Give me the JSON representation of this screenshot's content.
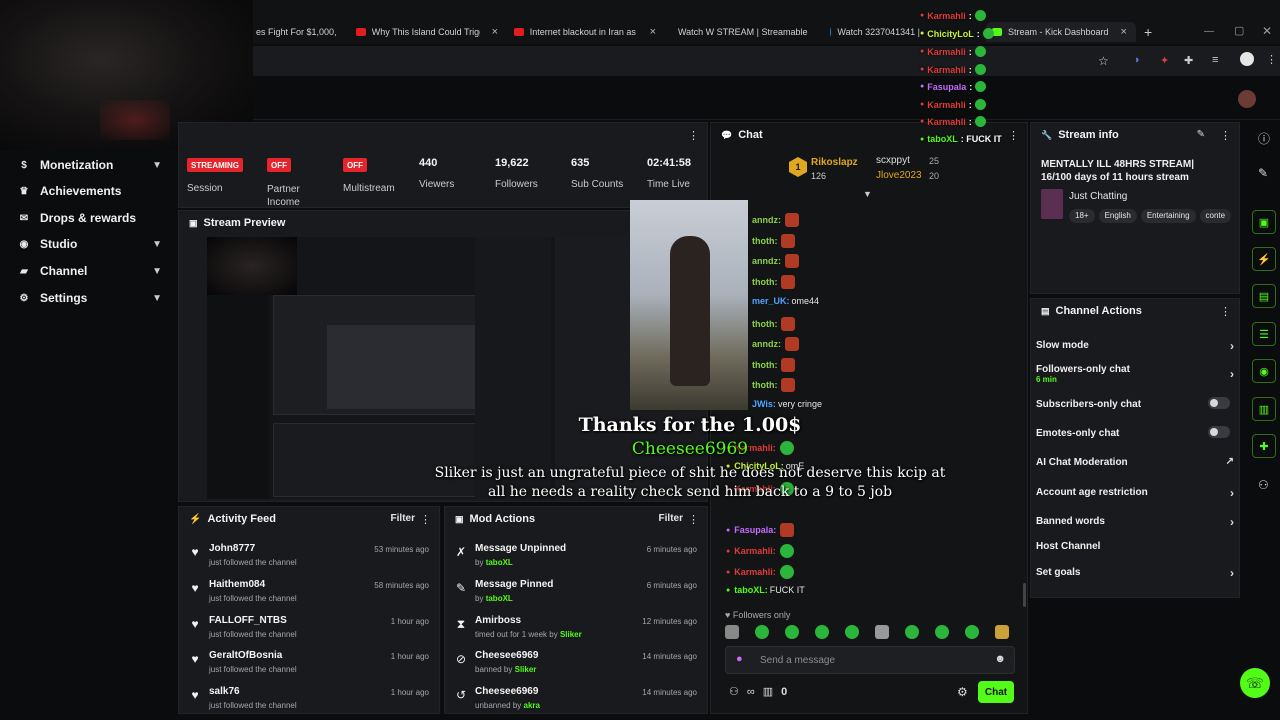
{
  "browser": {
    "tabs": [
      {
        "title": "es Fight For $1,000,",
        "fav": "#d83a3a"
      },
      {
        "title": "Why This Island Could Trigger W",
        "fav": "#e01e1e"
      },
      {
        "title": "Internet blackout in Iran as pro",
        "fav": "#e01e1e"
      },
      {
        "title": "Watch W STREAM | Streamable",
        "fav": "#1f7ad6"
      },
      {
        "title": "Watch 3237041341 |",
        "fav": "#1f7ad6"
      },
      {
        "title": "Stream - Kick Dashboard",
        "fav": "#53fc18"
      }
    ],
    "new_tab": "+"
  },
  "sidebar": {
    "items": [
      {
        "label": "Monetization",
        "icon": "dollar-icon",
        "glyph": "$",
        "chevron": true
      },
      {
        "label": "Achievements",
        "icon": "trophy-icon",
        "glyph": "♛",
        "chevron": false
      },
      {
        "label": "Drops & rewards",
        "icon": "gift-icon",
        "glyph": "✉",
        "chevron": false
      },
      {
        "label": "Studio",
        "icon": "target-icon",
        "glyph": "◉",
        "chevron": true
      },
      {
        "label": "Channel",
        "icon": "channel-icon",
        "glyph": "▰",
        "chevron": true
      },
      {
        "label": "Settings",
        "icon": "gear-icon",
        "glyph": "⚙",
        "chevron": true
      }
    ]
  },
  "stats": {
    "session": {
      "badge": "STREAMING",
      "label": "Session"
    },
    "partner": {
      "badge": "OFF",
      "label": "Partner Income"
    },
    "multistream": {
      "badge": "OFF",
      "label": "Multistream"
    },
    "viewers": {
      "value": "440",
      "label": "Viewers"
    },
    "followers": {
      "value": "19,622",
      "label": "Followers"
    },
    "subs": {
      "value": "635",
      "label": "Sub Counts"
    },
    "time": {
      "value": "02:41:58",
      "label": "Time Live"
    }
  },
  "stream_preview": {
    "title": "Stream Preview"
  },
  "activity": {
    "title": "Activity Feed",
    "filter": "Filter",
    "rows": [
      {
        "name": "John8777",
        "sub": "just followed the channel",
        "time": "53 minutes ago"
      },
      {
        "name": "Haithem084",
        "sub": "just followed the channel",
        "time": "58 minutes ago"
      },
      {
        "name": "FALLOFF_NTBS",
        "sub": "just followed the channel",
        "time": "1 hour ago"
      },
      {
        "name": "GeraltOfBosnia",
        "sub": "just followed the channel",
        "time": "1 hour ago"
      },
      {
        "name": "salk76",
        "sub": "just followed the channel",
        "time": "1 hour ago"
      }
    ]
  },
  "mod": {
    "title": "Mod Actions",
    "filter": "Filter",
    "rows": [
      {
        "name": "Message Unpinned",
        "pre": "by",
        "user": "taboXL",
        "time": "6 minutes ago",
        "icon": "unpin-icon",
        "glyph": "✗"
      },
      {
        "name": "Message Pinned",
        "pre": "by",
        "user": "taboXL",
        "time": "6 minutes ago",
        "icon": "pin-icon",
        "glyph": "✎"
      },
      {
        "name": "Amirboss",
        "pre": "timed out for 1 week by",
        "user": "Sliker",
        "time": "12 minutes ago",
        "icon": "hourglass-icon",
        "glyph": "⧗"
      },
      {
        "name": "Cheesee6969",
        "pre": "banned by",
        "user": "Sliker",
        "time": "14 minutes ago",
        "icon": "ban-icon",
        "glyph": "⊘"
      },
      {
        "name": "Cheesee6969",
        "pre": "unbanned by",
        "user": "akra",
        "time": "14 minutes ago",
        "icon": "undo-icon",
        "glyph": "↺"
      }
    ]
  },
  "chat": {
    "title": "Chat",
    "top_gifters": [
      {
        "rank": "1",
        "name": "Rikoslapz",
        "count": "126"
      },
      {
        "name": "scxppyt",
        "count": "25"
      },
      {
        "name": "Jlove2023",
        "count": "20"
      }
    ],
    "messages": [
      {
        "user": "anndz:",
        "color": "#8bd14a",
        "text": "",
        "emote": "red"
      },
      {
        "user": "thoth:",
        "color": "#8bd14a",
        "text": "",
        "emote": "red"
      },
      {
        "user": "anndz:",
        "color": "#8bd14a",
        "text": "",
        "emote": "red"
      },
      {
        "user": "thoth:",
        "color": "#8bd14a",
        "text": "",
        "emote": "red"
      },
      {
        "user": "mer_UK:",
        "color": "#4fa3ff",
        "text": "ome44",
        "emote": ""
      },
      {
        "user": "thoth:",
        "color": "#8bd14a",
        "text": "",
        "emote": "red"
      },
      {
        "user": "anndz:",
        "color": "#8bd14a",
        "text": "",
        "emote": "red"
      },
      {
        "user": "thoth:",
        "color": "#8bd14a",
        "text": "",
        "emote": "red"
      },
      {
        "user": "thoth:",
        "color": "#8bd14a",
        "text": "",
        "emote": "red"
      },
      {
        "user": "JWis:",
        "color": "#4fa3ff",
        "text": "very cringe",
        "emote": ""
      },
      {
        "user": "Karmahli:",
        "color": "#e03b3b",
        "text": "",
        "emote": "green"
      },
      {
        "user": "ChicityLoL:",
        "color": "#c6f23b",
        "text": "omE",
        "emote": ""
      },
      {
        "user": "Karmahli:",
        "color": "#e03b3b",
        "text": "",
        "emote": "green"
      },
      {
        "user": "Fasupala:",
        "color": "#c56bff",
        "text": "",
        "emote": "red"
      },
      {
        "user": "Karmahli:",
        "color": "#e03b3b",
        "text": "",
        "emote": "green"
      },
      {
        "user": "Karmahli:",
        "color": "#e03b3b",
        "text": "",
        "emote": "green"
      },
      {
        "user": "taboXL:",
        "color": "#53fc18",
        "text": "FUCK IT",
        "emote": ""
      }
    ],
    "followers_only": "Followers only",
    "input_placeholder": "Send a message",
    "send_label": "Chat",
    "count": "0"
  },
  "overlay_chat": [
    {
      "user": "Karmahli",
      "color": "#e03b3b",
      "text": ":"
    },
    {
      "user": "ChicityLoL",
      "color": "#c6f23b",
      "text": ":"
    },
    {
      "user": "Karmahli",
      "color": "#e03b3b",
      "text": ":"
    },
    {
      "user": "Karmahli",
      "color": "#e03b3b",
      "text": ":"
    },
    {
      "user": "Fasupala",
      "color": "#c56bff",
      "text": ":"
    },
    {
      "user": "Karmahli",
      "color": "#e03b3b",
      "text": ":"
    },
    {
      "user": "Karmahli",
      "color": "#e03b3b",
      "text": ":"
    },
    {
      "user": "taboXL",
      "color": "#53fc18",
      "text": ": FUCK IT"
    }
  ],
  "overlay_captions": {
    "thanks": "Thanks for the 1.00$",
    "donor": "Cheesee6969",
    "message": "Sliker is just an ungrateful piece of shit he does not deserve this kcip at all he needs a reality check send him back to a 9 to 5 job"
  },
  "stream_info": {
    "title": "Stream info",
    "stream_title": "MENTALLY ILL 48HRS STREAM| 16/100 days of 11 hours stream",
    "category": "Just Chatting",
    "tags": [
      "18+",
      "English",
      "Entertaining",
      "conte"
    ]
  },
  "channel_actions": {
    "title": "Channel Actions",
    "items": [
      {
        "label": "Slow mode",
        "kind": "chevron"
      },
      {
        "label": "Followers-only chat",
        "sub": "6 min",
        "kind": "chevron"
      },
      {
        "label": "Subscribers-only chat",
        "kind": "toggle"
      },
      {
        "label": "Emotes-only chat",
        "kind": "toggle"
      },
      {
        "label": "AI Chat Moderation",
        "kind": "external"
      },
      {
        "label": "Account age restriction",
        "kind": "chevron"
      },
      {
        "label": "Banned words",
        "kind": "chevron"
      },
      {
        "label": "Host Channel",
        "kind": "none"
      },
      {
        "label": "Set goals",
        "kind": "chevron"
      }
    ]
  },
  "colors": {
    "accent": "#53fc18",
    "live": "#e5242b",
    "panel": "#191a1d"
  }
}
